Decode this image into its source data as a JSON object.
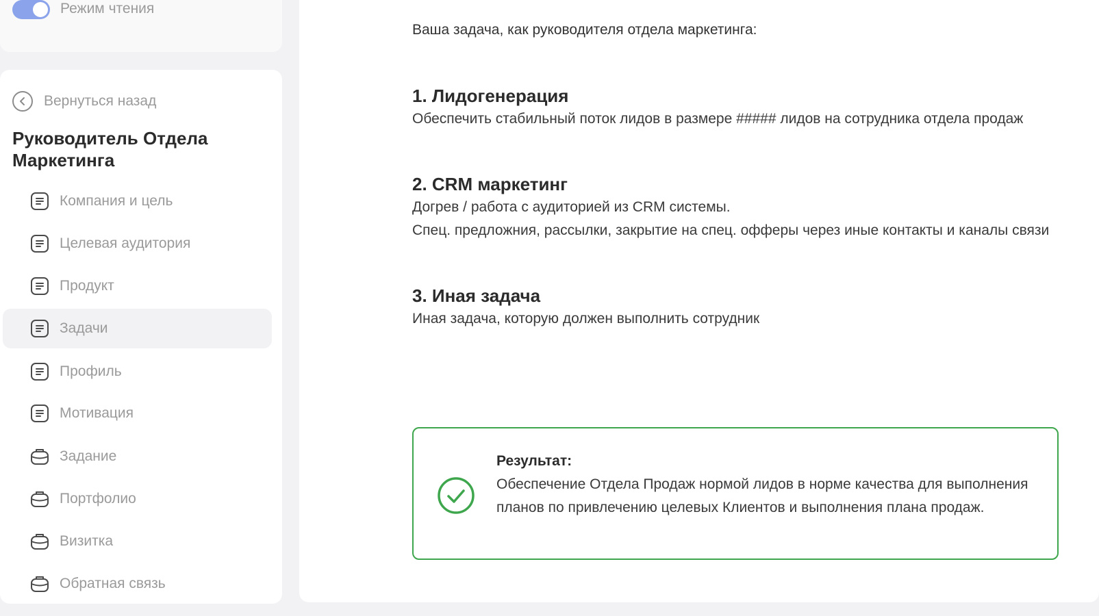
{
  "reading_mode": {
    "label": "Режим чтения",
    "enabled": true
  },
  "sidebar": {
    "back_label": "Вернуться назад",
    "title": "Руководитель Отдела Маркетинга",
    "items": [
      {
        "label": "Компания и цель",
        "icon": "document-icon"
      },
      {
        "label": "Целевая аудитория",
        "icon": "document-icon"
      },
      {
        "label": "Продукт",
        "icon": "document-icon"
      },
      {
        "label": "Задачи",
        "icon": "document-icon",
        "active": true
      },
      {
        "label": "Профиль",
        "icon": "document-icon"
      },
      {
        "label": "Мотивация",
        "icon": "document-icon"
      },
      {
        "label": "Задание",
        "icon": "briefcase-icon"
      },
      {
        "label": "Портфолио",
        "icon": "briefcase-icon"
      },
      {
        "label": "Визитка",
        "icon": "briefcase-icon"
      },
      {
        "label": "Обратная связь",
        "icon": "briefcase-icon"
      }
    ]
  },
  "main": {
    "intro": "Ваша задача, как руководителя отдела маркетинга:",
    "tasks": [
      {
        "title": "1. Лидогенерация",
        "lines": [
          "Обеспечить стабильный поток лидов в размере ##### лидов на сотрудника отдела продаж"
        ]
      },
      {
        "title": "2. CRM маркетинг",
        "lines": [
          "Догрев / работа с аудиторией из CRM системы.",
          "Спец. предложния, рассылки, закрытие на спец. офферы через иные контакты и каналы связи"
        ]
      },
      {
        "title": "3. Иная задача",
        "lines": [
          "Иная задача, которую должен выполнить сотрудник"
        ]
      }
    ],
    "result": {
      "title": "Результат:",
      "text": "Обеспечение Отдела Продаж нормой лидов в норме качества для выполнения планов по привлечению целевых Клиентов и выполнения плана продаж."
    }
  },
  "colors": {
    "accent_toggle": "#8aa3eb",
    "success": "#3ea64c"
  }
}
